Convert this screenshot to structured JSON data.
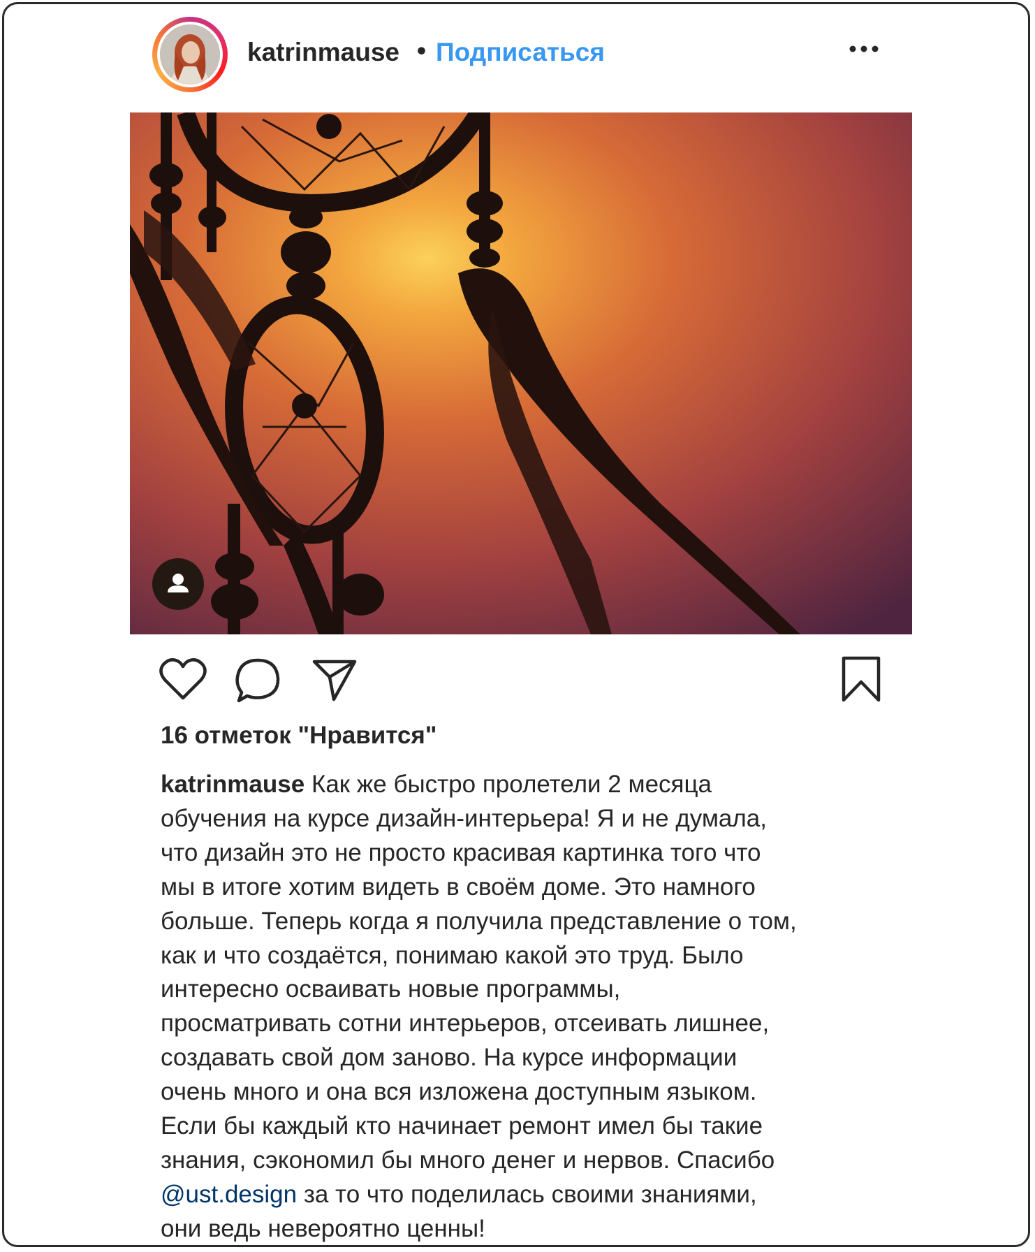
{
  "post": {
    "header": {
      "username": "katrinmause",
      "separator": "•",
      "follow_label": "Подписаться",
      "more_icon": "more-horizontal-icon"
    },
    "image": {
      "description_icon": "dreamcatcher-photo",
      "tag_icon": "user-tag-icon"
    },
    "actions": {
      "like_icon": "heart-icon",
      "comment_icon": "comment-icon",
      "share_icon": "send-icon",
      "save_icon": "bookmark-icon"
    },
    "likes_text": "16 отметок \"Нравится\"",
    "caption": {
      "username": "katrinmause",
      "lines": [
        "Как же быстро пролетели 2 месяца",
        "обучения на курсе дизайн-интерьера! Я и не думала,",
        "что дизайн это не просто красивая картинка того что",
        "мы в итоге хотим видеть в своём доме. Это намного",
        "больше. Теперь когда я получила представление о том,",
        "как и что создаётся, понимаю какой это труд. Было",
        "интересно осваивать новые программы,",
        "просматривать сотни интерьеров, отсеивать лишнее,",
        "создавать свой дом заново. На курсе информации",
        "очень много и она вся изложена доступным языком.",
        "Если бы каждый кто начинает ремонт имел бы такие",
        "знания, сэкономил бы много денег и нервов. Спасибо"
      ],
      "mention": "@ust.design",
      "mention_tail": " за то что поделилась своими знаниями,",
      "last_line": "они ведь невероятно ценны!"
    }
  },
  "colors": {
    "link_blue": "#3897f0",
    "mention_blue": "#003569",
    "text": "#262626"
  }
}
